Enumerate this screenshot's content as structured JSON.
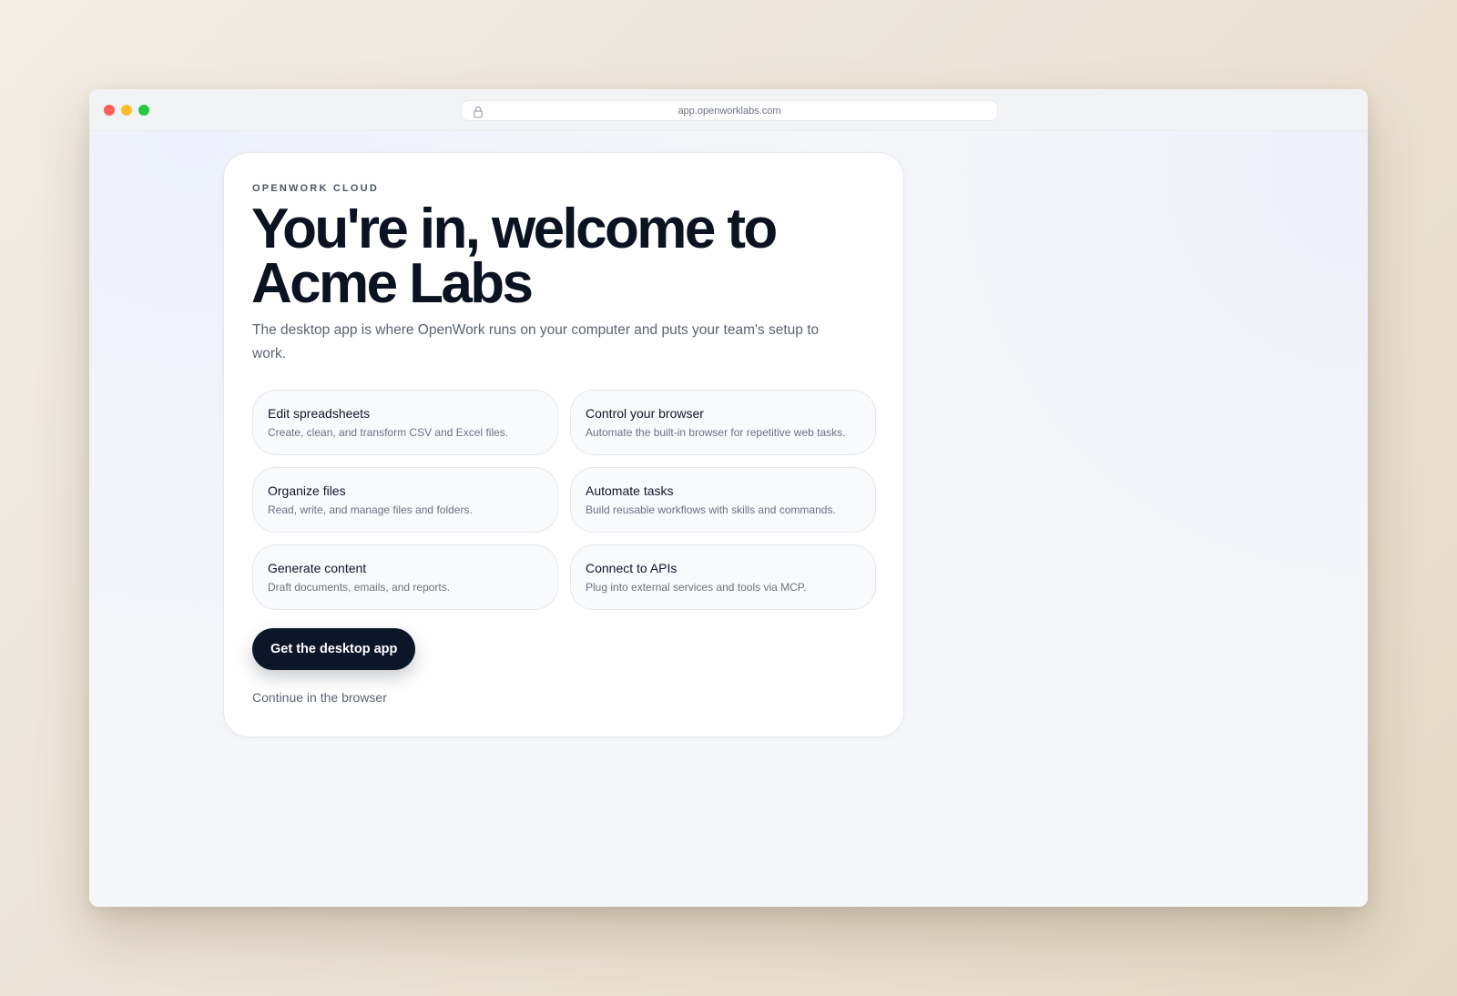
{
  "browser": {
    "url": "app.openworklabs.com"
  },
  "card": {
    "eyebrow": "OPENWORK CLOUD",
    "headline_line1": "You're in, welcome to",
    "headline_line2": "Acme Labs",
    "subtitle": "The desktop app is where OpenWork runs on your computer and puts your team's setup to work.",
    "features": [
      {
        "title": "Edit spreadsheets",
        "description": "Create, clean, and transform CSV and Excel files."
      },
      {
        "title": "Control your browser",
        "description": "Automate the built-in browser for repetitive web tasks."
      },
      {
        "title": "Organize files",
        "description": "Read, write, and manage files and folders."
      },
      {
        "title": "Automate tasks",
        "description": "Build reusable workflows with skills and commands."
      },
      {
        "title": "Generate content",
        "description": "Draft documents, emails, and reports."
      },
      {
        "title": "Connect to APIs",
        "description": "Plug into external services and tools via MCP."
      }
    ],
    "primary_button": "Get the desktop app",
    "secondary_link": "Continue in the browser"
  },
  "colors": {
    "primary": "#0b1628",
    "heading": "#0b1322",
    "muted_text": "#5b6472",
    "traffic_red": "#fe5f57",
    "traffic_yellow": "#febc2e",
    "traffic_green": "#28c840"
  },
  "icons": {
    "address_bar": "lock-icon"
  }
}
